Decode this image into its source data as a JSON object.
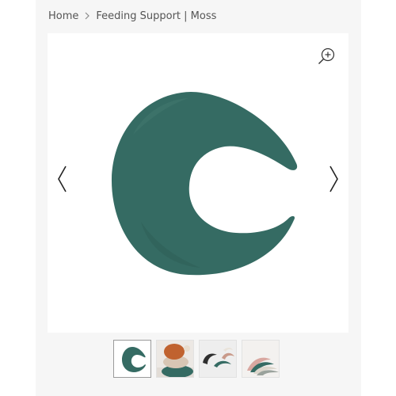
{
  "breadcrumb": {
    "home": "Home",
    "current": "Feeding Support | Moss"
  },
  "icons": {
    "zoom": "zoom-in-icon",
    "prev": "chevron-left-icon",
    "next": "chevron-right-icon",
    "separator": "chevron-right-icon"
  },
  "gallery": {
    "selected_index": 0,
    "thumbnail_count": 4
  },
  "colors": {
    "moss": "#356b63",
    "text": "#555555",
    "panel": "#f6f6f6"
  }
}
